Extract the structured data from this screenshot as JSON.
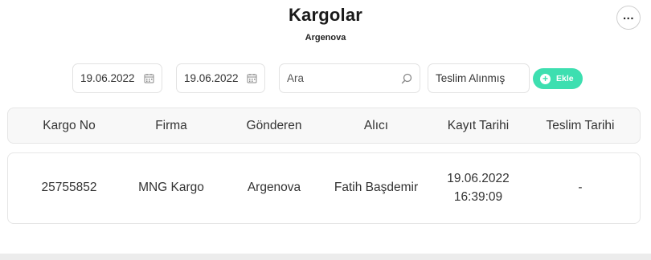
{
  "header": {
    "title": "Kargolar",
    "subtitle": "Argenova",
    "more_icon": "more-horizontal-icon"
  },
  "filters": {
    "start_date": "19.06.2022",
    "end_date": "19.06.2022",
    "search_placeholder": "Ara",
    "status": "Teslim Alınmış",
    "add_label": "Ekle",
    "icons": {
      "date": "calendar-icon",
      "search": "search-icon",
      "add": "plus-circle-icon"
    }
  },
  "table": {
    "columns": [
      "Kargo No",
      "Firma",
      "Gönderen",
      "Alıcı",
      "Kayıt Tarihi",
      "Teslim Tarihi"
    ],
    "rows": [
      {
        "kargo_no": "25755852",
        "firma": "MNG Kargo",
        "gonderen": "Argenova",
        "alici": "Fatih Başdemir",
        "kayit_tarihi": "19.06.2022",
        "kayit_saati": "16:39:09",
        "teslim_tarihi": "-"
      }
    ]
  },
  "colors": {
    "accent": "#3ddfb0",
    "border": "#e2e2e2",
    "header_bg": "#f8f8f8"
  }
}
